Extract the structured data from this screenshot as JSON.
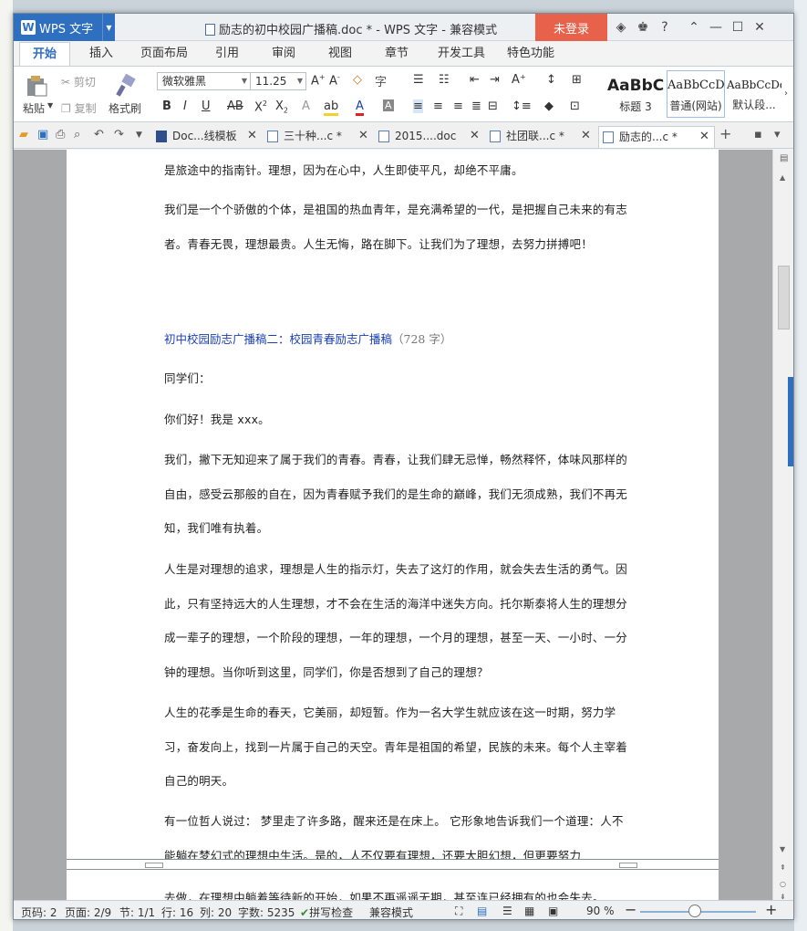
{
  "app": {
    "name": "WPS 文字",
    "logo_letter": "W"
  },
  "window": {
    "title": "励志的初中校园广播稿.doc * - WPS 文字 - 兼容模式",
    "login_label": "未登录"
  },
  "ribbon_tabs": [
    "开始",
    "插入",
    "页面布局",
    "引用",
    "审阅",
    "视图",
    "章节",
    "开发工具",
    "特色功能"
  ],
  "clipboard": {
    "paste": "粘贴",
    "cut": "剪切",
    "copy": "复制",
    "format_painter": "格式刷"
  },
  "font": {
    "family": "微软雅黑",
    "size": "11.25"
  },
  "styles": [
    {
      "sample": "AaBbC",
      "name": "标题 3"
    },
    {
      "sample": "AaBbCcD",
      "name": "普通(网站)"
    },
    {
      "sample": "AaBbCcDd",
      "name": "默认段..."
    }
  ],
  "doc_tabs": [
    "Doc...线模板",
    "三十种...c *",
    "2015....doc",
    "社团联...c *",
    "励志的...c *"
  ],
  "document": {
    "paragraphs_before": [
      "是旅途中的指南针。理想，因为在心中，人生即使平凡，却绝不平庸。",
      "我们是一个个骄傲的个体，是祖国的热血青年，是充满希望的一代，是把握自己未来的有志者。青春无畏，理想最贵。人生无悔，路在脚下。让我们为了理想，去努力拼搏吧！"
    ],
    "heading": "初中校园励志广播稿二：校园青春励志广播稿",
    "heading_count": "（728 字）",
    "greeting": "同学们：",
    "hello": "你们好！我是 xxx。",
    "paragraphs": [
      "我们，撇下无知迎来了属于我们的青春。青春，让我们肆无忌惮，畅然释怀，体味风那样的自由，感受云那般的自在，因为青春赋予我们的是生命的巅峰，我们无须成熟，我们不再无知，我们唯有执着。",
      "人生是对理想的追求，理想是人生的指示灯，失去了这灯的作用，就会失去生活的勇气。因此，只有坚持远大的人生理想，才不会在生活的海洋中迷失方向。托尔斯泰将人生的理想分成一辈子的理想，一个阶段的理想，一年的理想，一个月的理想，甚至一天、一小时、一分钟的理想。当你听到这里，同学们，你是否想到了自己的理想？",
      "人生的花季是生命的春天，它美丽，却短暂。作为一名大学生就应该在这一时期，努力学习，奋发向上，找到一片属于自己的天空。青年是祖国的希望，民族的未来。每个人主宰着自己的明天。",
      "有一位哲人说过：  梦里走了许多路，醒来还是在床上。  它形象地告诉我们一个道理：人不能躺在梦幻式的理想中生活。是的，人不仅要有理想，还要大胆幻想，但更要努力"
    ],
    "next_page_line": "去做，在理想中躺着等待新的开始，如果不再遥遥无期，甚至连已经拥有的也会失去。"
  },
  "status_bar": {
    "page": "页码: 2",
    "pages": "页面: 2/9",
    "section": "节: 1/1",
    "row": "行: 16",
    "col": "列: 20",
    "words": "字数: 5235",
    "spell": "拼写检查",
    "compat": "兼容模式",
    "zoom": "90 %"
  }
}
